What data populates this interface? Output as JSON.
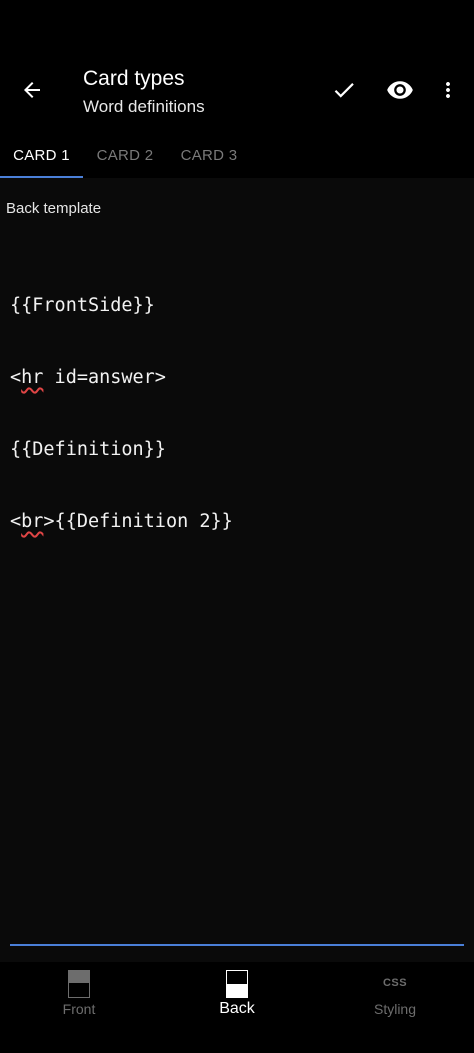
{
  "header": {
    "title": "Card types",
    "subtitle": "Word definitions",
    "back_icon": "arrow-left-icon",
    "actions": [
      "check-icon",
      "eye-icon",
      "more-vert-icon"
    ]
  },
  "tabs": [
    {
      "label": "CARD 1",
      "active": true
    },
    {
      "label": "CARD 2",
      "active": false
    },
    {
      "label": "CARD 3",
      "active": false
    }
  ],
  "editor": {
    "label": "Back template",
    "lines": [
      "{{FrontSide}}",
      "<hr id=answer>",
      "{{Definition}}",
      "<br>{{Definition 2}}"
    ]
  },
  "bottom_nav": [
    {
      "label": "Front",
      "icon": "front-template-icon",
      "active": false
    },
    {
      "label": "Back",
      "icon": "back-template-icon",
      "active": true
    },
    {
      "label": "Styling",
      "icon": "css-icon",
      "icon_text": "CSS",
      "active": false
    }
  ],
  "colors": {
    "accent": "#4a7fd8",
    "background": "#000000",
    "editor_background": "#0a0a0a",
    "spellcheck": "#e04545"
  }
}
